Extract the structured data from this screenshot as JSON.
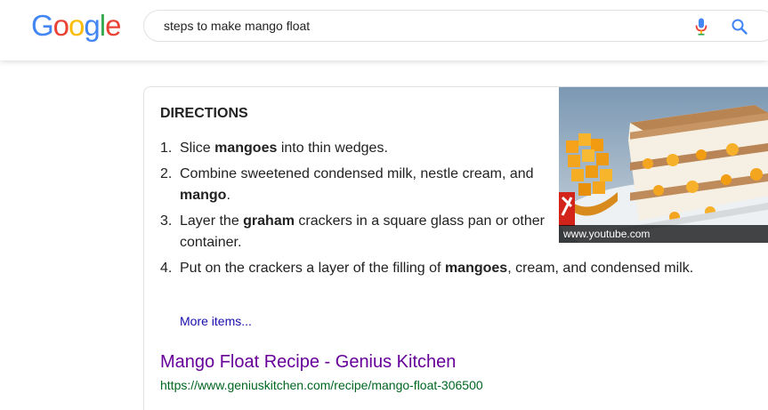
{
  "header": {
    "logo_letters": [
      {
        "ch": "G",
        "color": "#4285F4"
      },
      {
        "ch": "o",
        "color": "#EA4335"
      },
      {
        "ch": "o",
        "color": "#FBBC05"
      },
      {
        "ch": "g",
        "color": "#4285F4"
      },
      {
        "ch": "l",
        "color": "#34A853"
      },
      {
        "ch": "e",
        "color": "#EA4335"
      }
    ],
    "search_value": "steps to make mango float",
    "mic_icon": "mic-icon",
    "search_icon": "search-icon"
  },
  "snippet": {
    "heading": "DIRECTIONS",
    "steps": [
      {
        "num": "1.",
        "parts": [
          {
            "t": "Slice ",
            "b": false
          },
          {
            "t": "mangoes",
            "b": true
          },
          {
            "t": " into thin wedges.",
            "b": false
          }
        ]
      },
      {
        "num": "2.",
        "parts": [
          {
            "t": "Combine sweetened condensed milk, nestle cream, and ",
            "b": false
          },
          {
            "t": "mango",
            "b": true
          },
          {
            "t": ".",
            "b": false
          }
        ]
      },
      {
        "num": "3.",
        "parts": [
          {
            "t": "Layer the ",
            "b": false
          },
          {
            "t": "graham",
            "b": true
          },
          {
            "t": " crackers in a square glass pan or other container.",
            "b": false
          }
        ]
      },
      {
        "num": "4.",
        "parts": [
          {
            "t": "Put on the crackers a layer of the filling of ",
            "b": false
          },
          {
            "t": "mangoes",
            "b": true
          },
          {
            "t": ", cream, and condensed milk.",
            "b": false
          }
        ]
      }
    ],
    "more_items": "More items...",
    "image_caption": "www.youtube.com",
    "result_title": "Mango Float Recipe - Genius Kitchen",
    "result_url": "https://www.geniuskitchen.com/recipe/mango-float-306500"
  },
  "colors": {
    "link_visited": "#660099",
    "link": "#1a0dab",
    "url_green": "#006621",
    "google_blue": "#4285F4"
  }
}
